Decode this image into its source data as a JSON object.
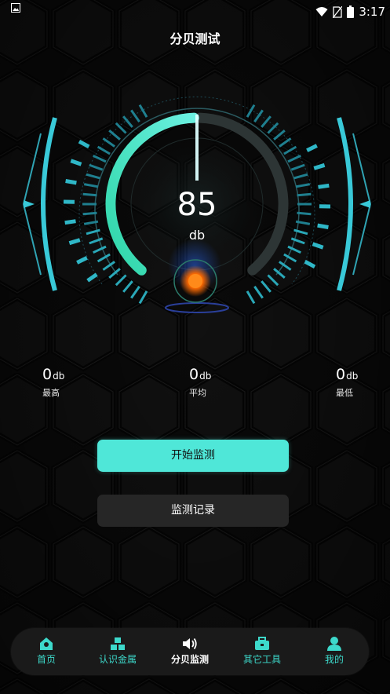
{
  "status_bar": {
    "time": "3:17",
    "icons": [
      "image-icon",
      "wifi-icon",
      "no-sim-icon",
      "battery-icon"
    ]
  },
  "page": {
    "title": "分贝测试"
  },
  "meter": {
    "value": "85",
    "unit": "db",
    "level_fraction": 0.85,
    "accent_color": "#4fe7d8",
    "indicator_color": "#ff7a1a"
  },
  "stats": [
    {
      "value": "0",
      "unit": "db",
      "label": "最高"
    },
    {
      "value": "0",
      "unit": "db",
      "label": "平均"
    },
    {
      "value": "0",
      "unit": "db",
      "label": "最低"
    }
  ],
  "actions": {
    "start_label": "开始监测",
    "records_label": "监测记录"
  },
  "tabbar": {
    "items": [
      {
        "label": "首页",
        "icon": "home-icon"
      },
      {
        "label": "认识金属",
        "icon": "blocks-icon"
      },
      {
        "label": "分贝监测",
        "icon": "speaker-icon",
        "active": true
      },
      {
        "label": "其它工具",
        "icon": "toolbox-icon"
      },
      {
        "label": "我的",
        "icon": "user-icon"
      }
    ]
  },
  "colors": {
    "background": "#0c0c0c",
    "accent": "#4fe7d8",
    "tab_label": "#3dd9cb",
    "button_dark": "#262626"
  }
}
